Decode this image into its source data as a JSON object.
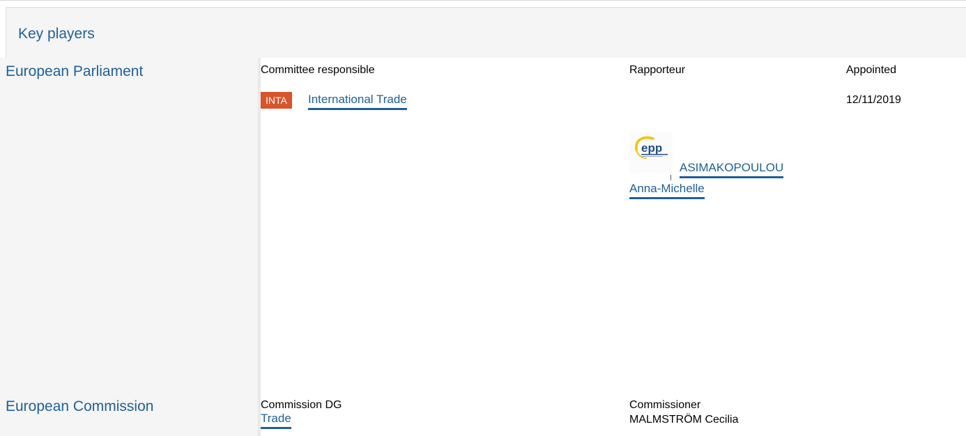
{
  "section": {
    "title": "Key players"
  },
  "parliament": {
    "label": "European Parliament",
    "col_committee": "Committee responsible",
    "col_rapporteur": "Rapporteur",
    "col_appointed": "Appointed",
    "committee_code": "INTA",
    "committee_name": "International Trade",
    "appointed_date": "12/11/2019",
    "rapporteur_group_logo": "epp-logo",
    "rapporteur_name_line1": "ASIMAKOPOULOU",
    "rapporteur_name_line2": "Anna-Michelle",
    "colors": {
      "link": "#1f5f99",
      "badge": "#d9532b"
    }
  },
  "commission": {
    "label": "European Commission",
    "col_dg": "Commission DG",
    "col_commissioner": "Commissioner",
    "dg_name": "Trade",
    "commissioner_name": "MALMSTRÖM Cecilia"
  }
}
